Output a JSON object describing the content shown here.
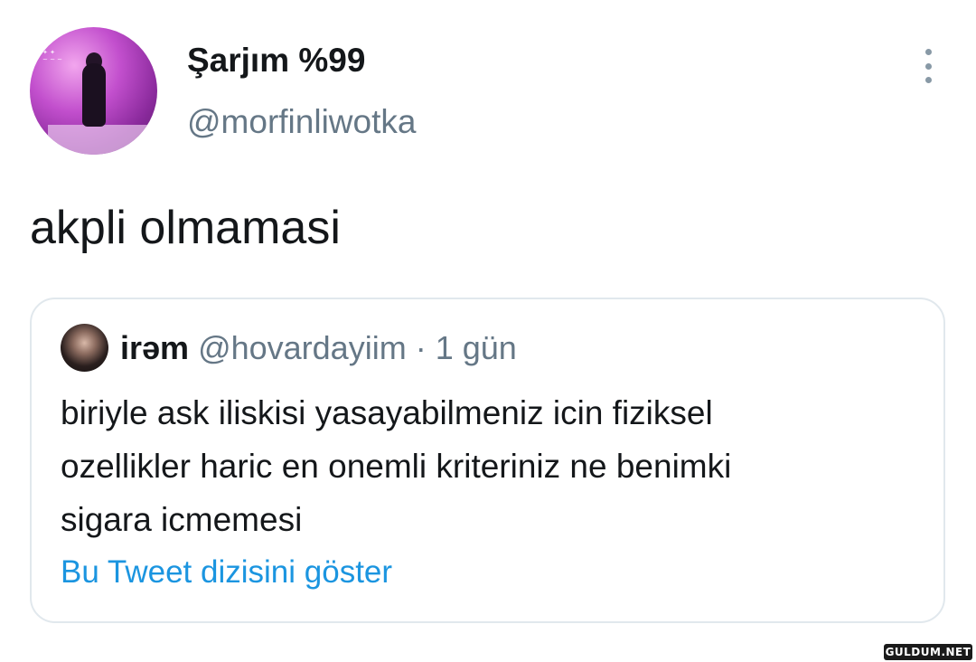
{
  "tweet": {
    "author": {
      "display_name": "Şarjım %99",
      "handle": "@morfinliwotka",
      "avatar_icon": "profile-photo-neon-pink"
    },
    "text": "akpli olmamasi",
    "more_icon": "more-vertical-icon"
  },
  "quoted_tweet": {
    "author": {
      "display_name": "irəm",
      "handle": "@hovardayiim",
      "avatar_icon": "profile-photo-dark"
    },
    "separator": "·",
    "time": "1 gün",
    "text_lines": [
      "biriyle ask iliskisi yasayabilmeniz icin fiziksel",
      "ozellikler haric en onemli kriteriniz ne benimki",
      "sigara icmemesi"
    ],
    "thread_link": "Bu Tweet dizisini göster"
  },
  "watermark": "GULDUM.NET",
  "colors": {
    "text_primary": "#14171a",
    "text_secondary": "#657786",
    "link": "#1b95e0",
    "border": "#e1e8ed"
  }
}
